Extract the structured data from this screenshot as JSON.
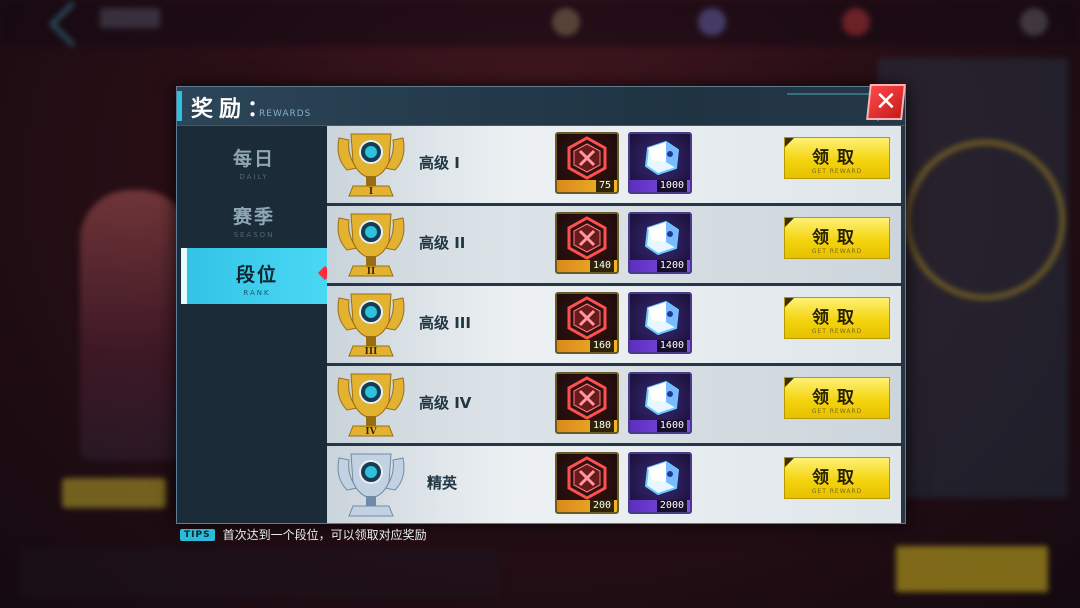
{
  "modal": {
    "title": "奖励：",
    "subtitle": "REWARDS",
    "close_glyph": "✕"
  },
  "sidebar": {
    "tabs": [
      {
        "label": "每日",
        "sub": "DAILY",
        "active": false
      },
      {
        "label": "赛季",
        "sub": "SEASON",
        "active": false
      },
      {
        "label": "段位",
        "sub": "RANK",
        "active": true
      }
    ]
  },
  "rewards": [
    {
      "rank": "高级 I",
      "trophy": "gold",
      "tier_mark": "I",
      "items": [
        {
          "icon": "red-hexagon-token-icon",
          "qty": "75"
        },
        {
          "icon": "blue-cube-crystal-icon",
          "qty": "1000"
        }
      ],
      "claim_label": "领取",
      "claim_sub": "GET REWARD"
    },
    {
      "rank": "高级 II",
      "trophy": "gold",
      "tier_mark": "II",
      "items": [
        {
          "icon": "red-hexagon-token-icon",
          "qty": "140"
        },
        {
          "icon": "blue-cube-crystal-icon",
          "qty": "1200"
        }
      ],
      "claim_label": "领取",
      "claim_sub": "GET REWARD"
    },
    {
      "rank": "高级 III",
      "trophy": "gold",
      "tier_mark": "III",
      "items": [
        {
          "icon": "red-hexagon-token-icon",
          "qty": "160"
        },
        {
          "icon": "blue-cube-crystal-icon",
          "qty": "1400"
        }
      ],
      "claim_label": "领取",
      "claim_sub": "GET REWARD"
    },
    {
      "rank": "高级 IV",
      "trophy": "gold",
      "tier_mark": "IV",
      "items": [
        {
          "icon": "red-hexagon-token-icon",
          "qty": "180"
        },
        {
          "icon": "blue-cube-crystal-icon",
          "qty": "1600"
        }
      ],
      "claim_label": "领取",
      "claim_sub": "GET REWARD"
    },
    {
      "rank": "精英",
      "trophy": "silver",
      "tier_mark": "",
      "items": [
        {
          "icon": "red-hexagon-token-icon",
          "qty": "200"
        },
        {
          "icon": "blue-cube-crystal-icon",
          "qty": "2000"
        }
      ],
      "claim_label": "领取",
      "claim_sub": "GET REWARD"
    }
  ],
  "tips": {
    "badge": "TIPS",
    "text": "首次达到一个段位，可以领取对应奖励"
  },
  "colors": {
    "accent": "#2ec0e0",
    "claim_yellow": "#f3d40f",
    "close_red": "#e02a2a",
    "gold": "#e0b430",
    "silver": "#b8c6d6"
  }
}
